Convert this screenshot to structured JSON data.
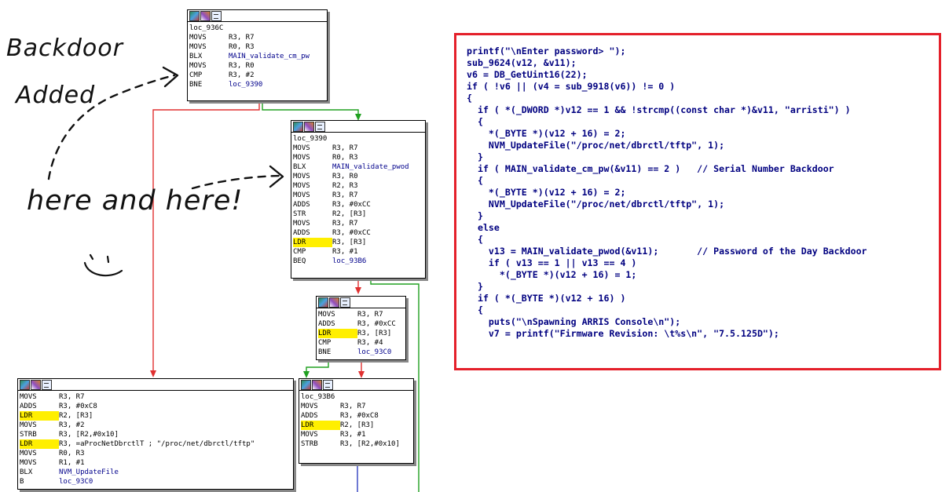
{
  "annotations": {
    "line1": "Backdoor",
    "line2": "Added",
    "line3": "here and here!",
    "smiley": ":)"
  },
  "nodes": {
    "n936c": {
      "label": "loc_936C",
      "lines": [
        {
          "m": "MOVS",
          "o": "R3, R7"
        },
        {
          "m": "MOVS",
          "o": "R0, R3"
        },
        {
          "m": "BLX",
          "o": "MAIN_validate_cm_pw"
        },
        {
          "m": "MOVS",
          "o": "R3, R0"
        },
        {
          "m": "CMP",
          "o": "R3, #2"
        },
        {
          "m": "BNE",
          "o": "loc_9390"
        }
      ]
    },
    "n9390": {
      "label": "loc_9390",
      "lines": [
        {
          "m": "MOVS",
          "o": "R3, R7"
        },
        {
          "m": "MOVS",
          "o": "R0, R3"
        },
        {
          "m": "BLX",
          "o": "MAIN_validate_pwod"
        },
        {
          "m": "MOVS",
          "o": "R3, R0"
        },
        {
          "m": "MOVS",
          "o": "R2, R3"
        },
        {
          "m": "MOVS",
          "o": "R3, R7"
        },
        {
          "m": "ADDS",
          "o": "R3, #0xCC"
        },
        {
          "m": "STR",
          "o": "R2, [R3]"
        },
        {
          "m": "MOVS",
          "o": "R3, R7"
        },
        {
          "m": "ADDS",
          "o": "R3, #0xCC"
        },
        {
          "m": "LDR",
          "o": "R3, [R3]",
          "hl": true
        },
        {
          "m": "CMP",
          "o": "R3, #1"
        },
        {
          "m": "BEQ",
          "o": "loc_93B6"
        }
      ]
    },
    "nmid": {
      "label": "",
      "lines": [
        {
          "m": "MOVS",
          "o": "R3, R7"
        },
        {
          "m": "ADDS",
          "o": "R3, #0xCC"
        },
        {
          "m": "LDR",
          "o": "R3, [R3]",
          "hl": true
        },
        {
          "m": "CMP",
          "o": "R3, #4"
        },
        {
          "m": "BNE",
          "o": "loc_93C0"
        }
      ]
    },
    "nleft": {
      "label": "",
      "lines": [
        {
          "m": "MOVS",
          "o": "R3, R7"
        },
        {
          "m": "ADDS",
          "o": "R3, #0xC8"
        },
        {
          "m": "LDR",
          "o": "R2, [R3]",
          "hl": true
        },
        {
          "m": "MOVS",
          "o": "R3, #2"
        },
        {
          "m": "STRB",
          "o": "R3, [R2,#0x10]"
        },
        {
          "m": "LDR",
          "o": "R3, =aProcNetDbrctlT ; \"/proc/net/dbrctl/tftp\"",
          "hl": true
        },
        {
          "m": "MOVS",
          "o": "R0, R3"
        },
        {
          "m": "MOVS",
          "o": "R1, #1"
        },
        {
          "m": "BLX",
          "o": "NVM_UpdateFile"
        },
        {
          "m": "B",
          "o": "loc_93C0"
        }
      ]
    },
    "n93b6": {
      "label": "loc_93B6",
      "lines": [
        {
          "m": "MOVS",
          "o": "R3, R7"
        },
        {
          "m": "ADDS",
          "o": "R3, #0xC8"
        },
        {
          "m": "LDR",
          "o": "R2, [R3]",
          "hl": true
        },
        {
          "m": "MOVS",
          "o": "R3, #1"
        },
        {
          "m": "STRB",
          "o": "R3, [R2,#0x10]"
        }
      ]
    }
  },
  "pseudocode": [
    "printf(\"\\nEnter password> \");",
    "sub_9624(v12, &v11);",
    "v6 = DB_GetUint16(22);",
    "if ( !v6 || (v4 = sub_9918(v6)) != 0 )",
    "{",
    "  if ( *(_DWORD *)v12 == 1 && !strcmp((const char *)&v11, \"arristi\") )",
    "  {",
    "    *(_BYTE *)(v12 + 16) = 2;",
    "    NVM_UpdateFile(\"/proc/net/dbrctl/tftp\", 1);",
    "  }",
    "  if ( MAIN_validate_cm_pw(&v11) == 2 )   // Serial Number Backdoor",
    "  {",
    "    *(_BYTE *)(v12 + 16) = 2;",
    "    NVM_UpdateFile(\"/proc/net/dbrctl/tftp\", 1);",
    "  }",
    "  else",
    "  {",
    "    v13 = MAIN_validate_pwod(&v11);       // Password of the Day Backdoor",
    "    if ( v13 == 1 || v13 == 4 )",
    "      *(_BYTE *)(v12 + 16) = 1;",
    "  }",
    "  if ( *(_BYTE *)(v12 + 16) )",
    "  {",
    "    puts(\"\\nSpawning ARRIS Console\\n\");",
    "    v7 = printf(\"Firmware Revision: \\t%s\\n\", \"7.5.125D\");"
  ],
  "colors": {
    "box_border": "#e4202a",
    "edge_false": "#e03030",
    "edge_true": "#20a020",
    "edge_plain": "#3040c0",
    "highlight": "#ffef00"
  }
}
